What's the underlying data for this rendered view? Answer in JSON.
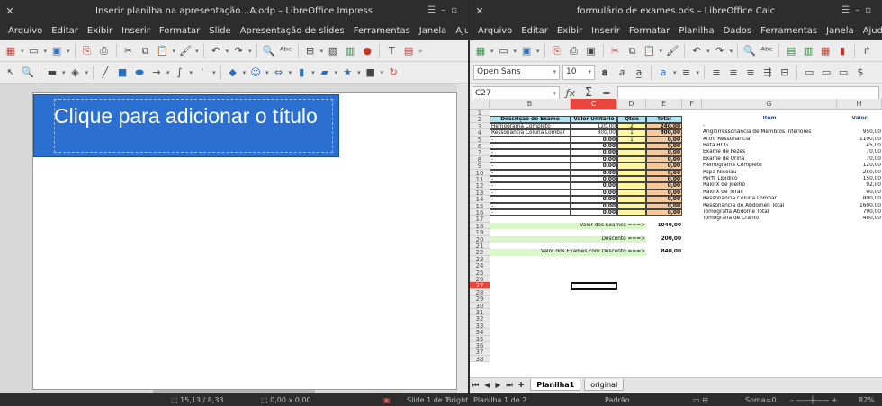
{
  "impress": {
    "title": "Inserir planilha na apresentação…A.odp – LibreOffice Impress",
    "menu": [
      "Arquivo",
      "Editar",
      "Exibir",
      "Inserir",
      "Formatar",
      "Slide",
      "Apresentação de slides",
      "Ferramentas",
      "Janela",
      "Ajuda"
    ],
    "slide_title": "Clique para adicionar o título",
    "status": {
      "position": "15,13 / 8,33",
      "size": "0,00 x 0,00",
      "slide": "Slide 1 de 1",
      "theme": "Bright"
    }
  },
  "calc": {
    "title": "formulário de exames.ods – LibreOffice Calc",
    "menu": [
      "Arquivo",
      "Editar",
      "Exibir",
      "Inserir",
      "Formatar",
      "Planilha",
      "Dados",
      "Ferramentas",
      "Janela",
      "Ajuda"
    ],
    "font_name": "Open Sans",
    "font_size": "10",
    "name_box": "C27",
    "columns": [
      "B",
      "C",
      "D",
      "E",
      "F",
      "G",
      "H"
    ],
    "rows": [
      "1",
      "2",
      "3",
      "4",
      "5",
      "6",
      "7",
      "8",
      "9",
      "10",
      "11",
      "12",
      "13",
      "14",
      "15",
      "16",
      "17",
      "18",
      "19",
      "20",
      "21",
      "22",
      "23",
      "24",
      "25",
      "26",
      "27",
      "28",
      "29",
      "30",
      "31",
      "32",
      "33",
      "34",
      "35",
      "36",
      "37",
      "38"
    ],
    "selected_row": "27",
    "selected_col": "C",
    "table_headers": {
      "descricao": "Descrição do Exame",
      "valor_unitario": "Valor Unitário",
      "qtde": "Qtde",
      "total": "Total"
    },
    "exam_rows": [
      {
        "desc": "Hemograma Completo",
        "unit": "120,00",
        "qtde": "2",
        "total": "240,00"
      },
      {
        "desc": "Ressonância Coluna Lombar",
        "unit": "800,00",
        "qtde": "1",
        "total": "800,00"
      },
      {
        "desc": "-",
        "unit": "0,00",
        "qtde": "1",
        "total": "0,00"
      },
      {
        "desc": "-",
        "unit": "0,00",
        "qtde": "",
        "total": "0,00"
      },
      {
        "desc": "-",
        "unit": "0,00",
        "qtde": "",
        "total": "0,00"
      },
      {
        "desc": "-",
        "unit": "0,00",
        "qtde": "",
        "total": "0,00"
      },
      {
        "desc": "-",
        "unit": "0,00",
        "qtde": "",
        "total": "0,00"
      },
      {
        "desc": "-",
        "unit": "0,00",
        "qtde": "",
        "total": "0,00"
      },
      {
        "desc": "-",
        "unit": "0,00",
        "qtde": "",
        "total": "0,00"
      },
      {
        "desc": "-",
        "unit": "0,00",
        "qtde": "",
        "total": "0,00"
      },
      {
        "desc": "-",
        "unit": "0,00",
        "qtde": "",
        "total": "0,00"
      },
      {
        "desc": "-",
        "unit": "0,00",
        "qtde": "",
        "total": "0,00"
      },
      {
        "desc": "-",
        "unit": "0,00",
        "qtde": "",
        "total": "0,00"
      },
      {
        "desc": "-",
        "unit": "0,00",
        "qtde": "",
        "total": "0,00"
      }
    ],
    "summary": {
      "valor_label": "Valor dos Exames ===>",
      "valor": "1040,00",
      "desconto_label": "Desconto ===>",
      "desconto": "200,00",
      "final_label": "Valor dos Exames com Desconto ===>",
      "final": "840,00"
    },
    "price_headers": {
      "item": "Item",
      "valor": "Valor"
    },
    "price_list": [
      {
        "item": "-",
        "valor": ""
      },
      {
        "item": "Angiorressonância de Membros Inferiores",
        "valor": "950,00"
      },
      {
        "item": "Artro Ressonância",
        "valor": "1100,00"
      },
      {
        "item": "Beta HCG",
        "valor": "45,00"
      },
      {
        "item": "Exame de Fezes",
        "valor": "70,00"
      },
      {
        "item": "Exame de Urina",
        "valor": "70,00"
      },
      {
        "item": "Hemograma Completo",
        "valor": "120,00"
      },
      {
        "item": "Papa Nicolau",
        "valor": "250,00"
      },
      {
        "item": "Perfil Lipídico",
        "valor": "150,00"
      },
      {
        "item": "Raio X de Joelho",
        "valor": "92,00"
      },
      {
        "item": "Raio X de Tórax",
        "valor": "80,00"
      },
      {
        "item": "Ressonância Coluna Lombar",
        "valor": "800,00"
      },
      {
        "item": "Ressonância de Abdômen Total",
        "valor": "1600,00"
      },
      {
        "item": "Tomografia Abdome Total",
        "valor": "790,00"
      },
      {
        "item": "Tomografia de Crânio",
        "valor": "480,00"
      }
    ],
    "sheets": [
      "Planilha1",
      "original"
    ],
    "status": {
      "sheet": "Planilha 1 de 2",
      "style": "Padrão",
      "sum": "Soma=0",
      "zoom": "82%"
    }
  }
}
